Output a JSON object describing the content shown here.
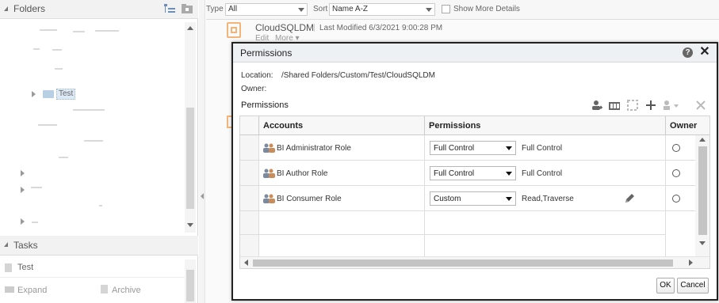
{
  "folders_panel": {
    "title": "Folders",
    "tree": {
      "selected_folder": "Test"
    }
  },
  "tasks_panel": {
    "title": "Tasks",
    "item": "Test",
    "actions": [
      "Expand",
      "Archive"
    ]
  },
  "filter_bar": {
    "type_label": "Type",
    "type_value": "All",
    "sort_label": "Sort",
    "sort_value": "Name A-Z",
    "show_more_label": "Show More Details"
  },
  "catalog_item": {
    "name": "CloudSQLDM",
    "last_modified": "Last Modified 6/3/2021 9:00:28 PM",
    "edit": "Edit",
    "more": "More ▾"
  },
  "dialog": {
    "title": "Permissions",
    "help": "?",
    "close": "✕",
    "location_label": "Location:",
    "location_value": "/Shared Folders/Custom/Test/CloudSQLDM",
    "owner_label": "Owner:",
    "section_title": "Permissions",
    "toolbar_icons": [
      "add-user-icon",
      "add-group-icon",
      "expand-icon",
      "plus-icon",
      "set-owner-icon",
      "delete-icon"
    ],
    "columns": [
      "Accounts",
      "Permissions",
      "Owner"
    ],
    "rows": [
      {
        "account": "BI Administrator Role",
        "permission": "Full Control",
        "detail": "Full Control"
      },
      {
        "account": "BI Author Role",
        "permission": "Full Control",
        "detail": "Full Control"
      },
      {
        "account": "BI Consumer Role",
        "permission": "Custom",
        "detail": "Read,Traverse"
      }
    ],
    "ok_label": "OK",
    "cancel_label": "Cancel"
  }
}
